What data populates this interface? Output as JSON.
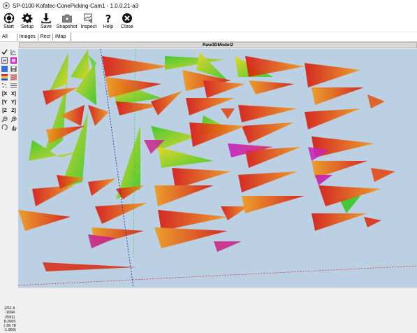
{
  "window": {
    "title": "SP-0100-Kofatec-ConePicking-Cam1 - 1.0.0.21-a3"
  },
  "toolbar": {
    "buttons": [
      {
        "label": "Start",
        "icon": "start-icon"
      },
      {
        "label": "Setup",
        "icon": "gear-icon"
      },
      {
        "label": "Save",
        "icon": "download-icon"
      },
      {
        "label": "Snapshot",
        "icon": "camera-icon"
      },
      {
        "label": "Inspect",
        "icon": "inspect-icon"
      },
      {
        "label": "Help",
        "icon": "help-icon"
      },
      {
        "label": "Close",
        "icon": "close-icon"
      }
    ]
  },
  "tabs": {
    "all": "All",
    "images": "Images",
    "rect": "Rect",
    "imap": "iMap"
  },
  "viewer": {
    "title": "Raw3DModel2",
    "coords": [
      "(211.6",
      "-1694",
      "2591)",
      "8.2665",
      "(-39.78",
      "-1.969)"
    ]
  },
  "colors": {
    "viewport_bg": "#bcd0e3",
    "axis_blue": "#1f2fa0",
    "axis_green": "#2ecc40",
    "axis_red": "#d02020",
    "cone_red": "#d81810",
    "cone_orange": "#f08a14",
    "cone_yellow": "#e8d81a",
    "cone_green": "#3cc82a",
    "cone_magenta": "#c820c8"
  }
}
